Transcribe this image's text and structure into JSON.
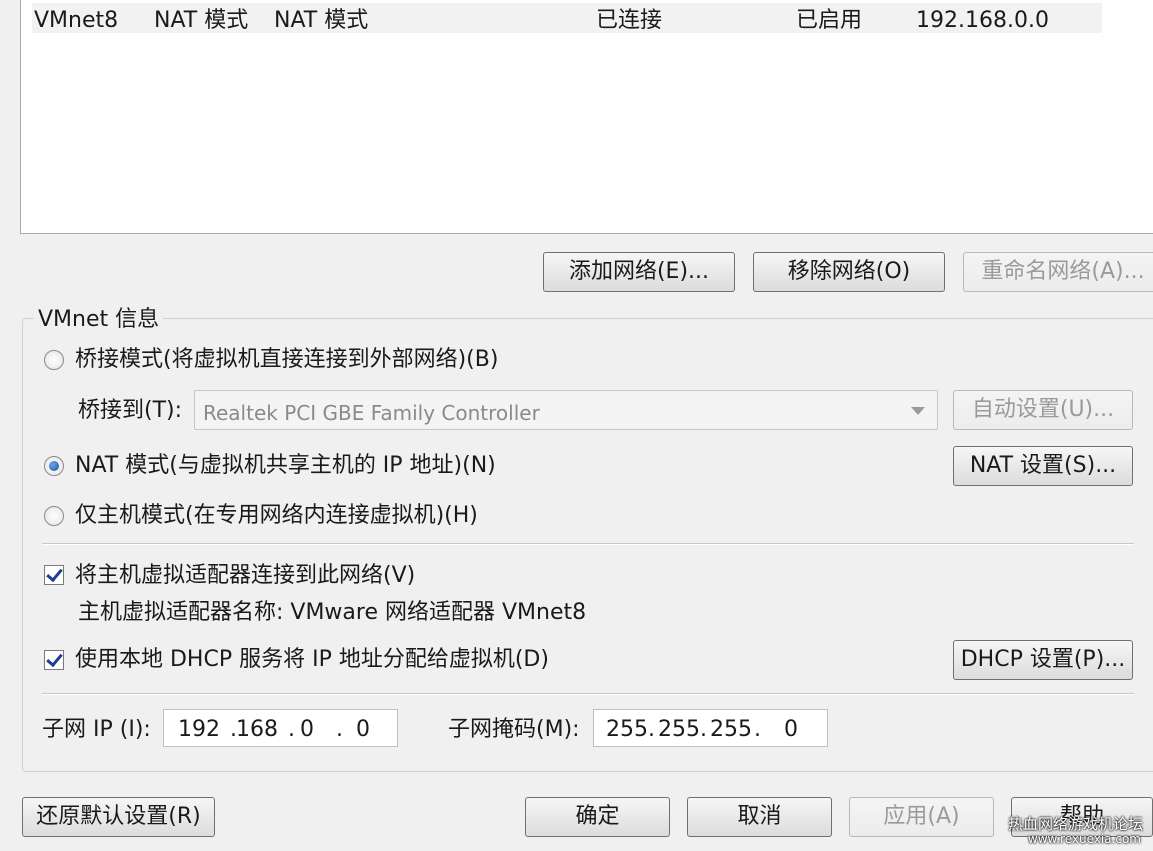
{
  "network_table": {
    "rows": [
      {
        "name": "VMnet8",
        "type": "NAT 模式",
        "external": "NAT 模式",
        "host_connection": "已连接",
        "dhcp": "已启用",
        "subnet": "192.168.0.0"
      }
    ]
  },
  "net_buttons": {
    "add": "添加网络(E)...",
    "remove": "移除网络(O)",
    "rename": "重命名网络(A)..."
  },
  "vmnet_info": {
    "title": "VMnet 信息",
    "bridged_label": "桥接模式(将虚拟机直接连接到外部网络)(B)",
    "bridge_to_label": "桥接到(T):",
    "bridge_to_value": "Realtek PCI GBE Family Controller",
    "auto_settings": "自动设置(U)...",
    "nat_label": "NAT 模式(与虚拟机共享主机的 IP 地址)(N)",
    "nat_settings": "NAT 设置(S)...",
    "hostonly_label": "仅主机模式(在专用网络内连接虚拟机)(H)",
    "selected_mode": "nat",
    "connect_adapter_label": "将主机虚拟适配器连接到此网络(V)",
    "connect_adapter_checked": true,
    "adapter_name_label": "主机虚拟适配器名称: VMware 网络适配器 VMnet8",
    "dhcp_label": "使用本地 DHCP 服务将 IP 地址分配给虚拟机(D)",
    "dhcp_checked": true,
    "dhcp_settings": "DHCP 设置(P)...",
    "subnet_ip_label": "子网 IP (I):",
    "subnet_ip": [
      "192",
      "168",
      "0",
      "0"
    ],
    "subnet_mask_label": "子网掩码(M):",
    "subnet_mask": [
      "255",
      "255",
      "255",
      "0"
    ]
  },
  "footer": {
    "restore": "还原默认设置(R)",
    "ok": "确定",
    "cancel": "取消",
    "apply": "应用(A)",
    "help": "帮助"
  },
  "watermark": {
    "line1": "热血网络游戏机论坛",
    "line2": "www.rexuexia.com"
  }
}
